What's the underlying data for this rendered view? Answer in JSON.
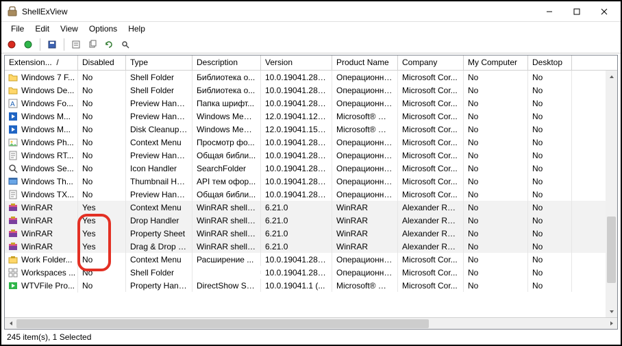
{
  "window": {
    "title": "ShellExView",
    "minimize": "—",
    "maximize": "□",
    "close": "×"
  },
  "menu": {
    "items": [
      "File",
      "Edit",
      "View",
      "Options",
      "Help"
    ]
  },
  "columns": [
    "Extension...",
    "Disabled",
    "Type",
    "Description",
    "Version",
    "Product Name",
    "Company",
    "My Computer",
    "Desktop"
  ],
  "rows": [
    {
      "icon": "folder",
      "name": "Windows 7 F...",
      "disabled": "No",
      "type": "Shell Folder",
      "desc": "Библиотека о...",
      "ver": "10.0.19041.284...",
      "prod": "Операционна...",
      "comp": "Microsoft Cor...",
      "mc": "No",
      "dt": "No",
      "hl": false
    },
    {
      "icon": "folder",
      "name": "Windows De...",
      "disabled": "No",
      "type": "Shell Folder",
      "desc": "Библиотека о...",
      "ver": "10.0.19041.284...",
      "prod": "Операционна...",
      "comp": "Microsoft Cor...",
      "mc": "No",
      "dt": "No",
      "hl": false
    },
    {
      "icon": "font",
      "name": "Windows Fo...",
      "disabled": "No",
      "type": "Preview Handler",
      "desc": "Папка шрифт...",
      "ver": "10.0.19041.284...",
      "prod": "Операционна...",
      "comp": "Microsoft Cor...",
      "mc": "No",
      "dt": "No",
      "hl": false
    },
    {
      "icon": "media",
      "name": "Windows M...",
      "disabled": "No",
      "type": "Preview Handler",
      "desc": "Windows Medi...",
      "ver": "12.0.19041.126...",
      "prod": "Microsoft® Wi...",
      "comp": "Microsoft Cor...",
      "mc": "No",
      "dt": "No",
      "hl": false
    },
    {
      "icon": "media",
      "name": "Windows M...",
      "disabled": "No",
      "type": "Disk Cleanup ...",
      "desc": "Windows Medi...",
      "ver": "12.0.19041.156...",
      "prod": "Microsoft® Wi...",
      "comp": "Microsoft Cor...",
      "mc": "No",
      "dt": "No",
      "hl": false
    },
    {
      "icon": "photo",
      "name": "Windows Ph...",
      "disabled": "No",
      "type": "Context Menu",
      "desc": "Просмотр фо...",
      "ver": "10.0.19041.284...",
      "prod": "Операционна...",
      "comp": "Microsoft Cor...",
      "mc": "No",
      "dt": "No",
      "hl": false
    },
    {
      "icon": "rtf",
      "name": "Windows RT...",
      "disabled": "No",
      "type": "Preview Handler",
      "desc": "Общая библи...",
      "ver": "10.0.19041.284...",
      "prod": "Операционна...",
      "comp": "Microsoft Cor...",
      "mc": "No",
      "dt": "No",
      "hl": false
    },
    {
      "icon": "search",
      "name": "Windows Se...",
      "disabled": "No",
      "type": "Icon Handler",
      "desc": "SearchFolder",
      "ver": "10.0.19041.284...",
      "prod": "Операционна...",
      "comp": "Microsoft Cor...",
      "mc": "No",
      "dt": "No",
      "hl": false
    },
    {
      "icon": "theme",
      "name": "Windows Th...",
      "disabled": "No",
      "type": "Thumbnail Ha...",
      "desc": "API тем офор...",
      "ver": "10.0.19041.284...",
      "prod": "Операционна...",
      "comp": "Microsoft Cor...",
      "mc": "No",
      "dt": "No",
      "hl": false
    },
    {
      "icon": "txt",
      "name": "Windows TX...",
      "disabled": "No",
      "type": "Preview Handler",
      "desc": "Общая библи...",
      "ver": "10.0.19041.284...",
      "prod": "Операционна...",
      "comp": "Microsoft Cor...",
      "mc": "No",
      "dt": "No",
      "hl": false
    },
    {
      "icon": "winrar",
      "name": "WinRAR",
      "disabled": "Yes",
      "type": "Context Menu",
      "desc": "WinRAR shell e...",
      "ver": "6.21.0",
      "prod": "WinRAR",
      "comp": "Alexander Ros...",
      "mc": "No",
      "dt": "No",
      "hl": true
    },
    {
      "icon": "winrar",
      "name": "WinRAR",
      "disabled": "Yes",
      "type": "Drop Handler",
      "desc": "WinRAR shell e...",
      "ver": "6.21.0",
      "prod": "WinRAR",
      "comp": "Alexander Ros...",
      "mc": "No",
      "dt": "No",
      "hl": true
    },
    {
      "icon": "winrar",
      "name": "WinRAR",
      "disabled": "Yes",
      "type": "Property Sheet",
      "desc": "WinRAR shell e...",
      "ver": "6.21.0",
      "prod": "WinRAR",
      "comp": "Alexander Ros...",
      "mc": "No",
      "dt": "No",
      "hl": true
    },
    {
      "icon": "winrar2",
      "name": "WinRAR",
      "disabled": "Yes",
      "type": "Drag & Drop H...",
      "desc": "WinRAR shell e...",
      "ver": "6.21.0",
      "prod": "WinRAR",
      "comp": "Alexander Ros...",
      "mc": "No",
      "dt": "No",
      "hl": true
    },
    {
      "icon": "work",
      "name": "Work Folder...",
      "disabled": "No",
      "type": "Context Menu",
      "desc": "Расширение ...",
      "ver": "10.0.19041.284...",
      "prod": "Операционна...",
      "comp": "Microsoft Cor...",
      "mc": "No",
      "dt": "No",
      "hl": false
    },
    {
      "icon": "ws",
      "name": "Workspaces ...",
      "disabled": "No",
      "type": "Shell Folder",
      "desc": "",
      "ver": "10.0.19041.284...",
      "prod": "Операционна...",
      "comp": "Microsoft Cor...",
      "mc": "No",
      "dt": "No",
      "hl": false
    },
    {
      "icon": "wtv",
      "name": "WTVFile Pro...",
      "disabled": "No",
      "type": "Property Hand...",
      "desc": "DirectShow Str...",
      "ver": "10.0.19041.1 (...",
      "prod": "Microsoft® Wi...",
      "comp": "Microsoft Cor...",
      "mc": "No",
      "dt": "No",
      "hl": false
    }
  ],
  "status": "245 item(s), 1 Selected",
  "sort_indicator": "/"
}
